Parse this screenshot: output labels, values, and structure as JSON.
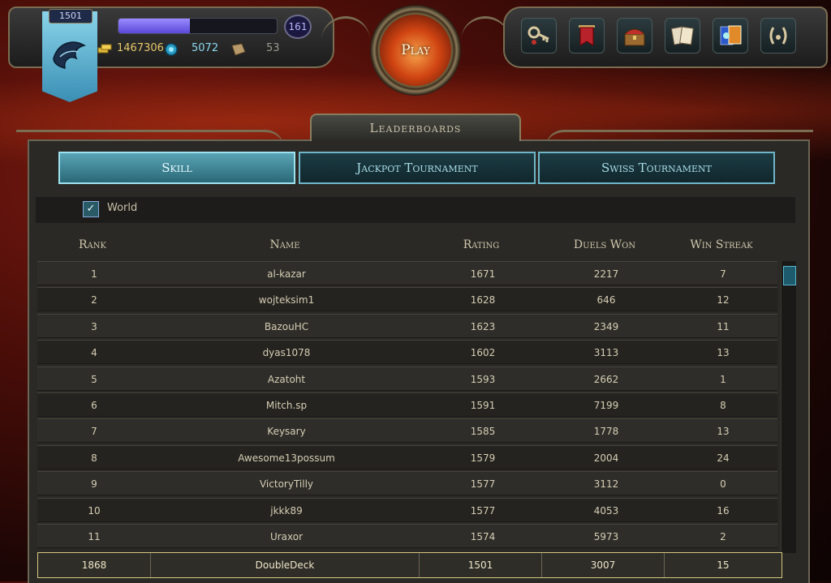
{
  "player": {
    "level_badge": "1501",
    "xp_fraction": 0.45,
    "xp_level": "161",
    "gold": "1467306",
    "gems": "5072",
    "scrolls": "53"
  },
  "play": {
    "label": "Play"
  },
  "nav_icons": [
    "key-icon",
    "banner-icon",
    "treasure-chest-icon",
    "cards-icon",
    "deck-icon",
    "laurel-icon"
  ],
  "panel": {
    "title": "Leaderboards"
  },
  "tabs": [
    {
      "label": "Skill",
      "active": true
    },
    {
      "label": "Jackpot Tournament",
      "active": false
    },
    {
      "label": "Swiss Tournament",
      "active": false
    }
  ],
  "filter": {
    "world_label": "World",
    "world_checked": true
  },
  "columns": [
    "Rank",
    "Name",
    "Rating",
    "Duels Won",
    "Win Streak"
  ],
  "rows": [
    [
      "1",
      "al-kazar",
      "1671",
      "2217",
      "7"
    ],
    [
      "2",
      "wojteksim1",
      "1628",
      "646",
      "12"
    ],
    [
      "3",
      "BazouHC",
      "1623",
      "2349",
      "11"
    ],
    [
      "4",
      "dyas1078",
      "1602",
      "3113",
      "13"
    ],
    [
      "5",
      "Azatoht",
      "1593",
      "2662",
      "1"
    ],
    [
      "6",
      "Mitch.sp",
      "1591",
      "7199",
      "8"
    ],
    [
      "7",
      "Keysary",
      "1585",
      "1778",
      "13"
    ],
    [
      "8",
      "Awesome13possum",
      "1579",
      "2004",
      "24"
    ],
    [
      "9",
      "VictoryTilly",
      "1577",
      "3112",
      "0"
    ],
    [
      "10",
      "jkkk89",
      "1577",
      "4053",
      "16"
    ],
    [
      "11",
      "Uraxor",
      "1574",
      "5973",
      "2"
    ]
  ],
  "me": [
    "1868",
    "DoubleDeck",
    "1501",
    "3007",
    "15"
  ],
  "colors": {
    "accent": "#6fb6c9",
    "highlight": "#d8c77e"
  }
}
